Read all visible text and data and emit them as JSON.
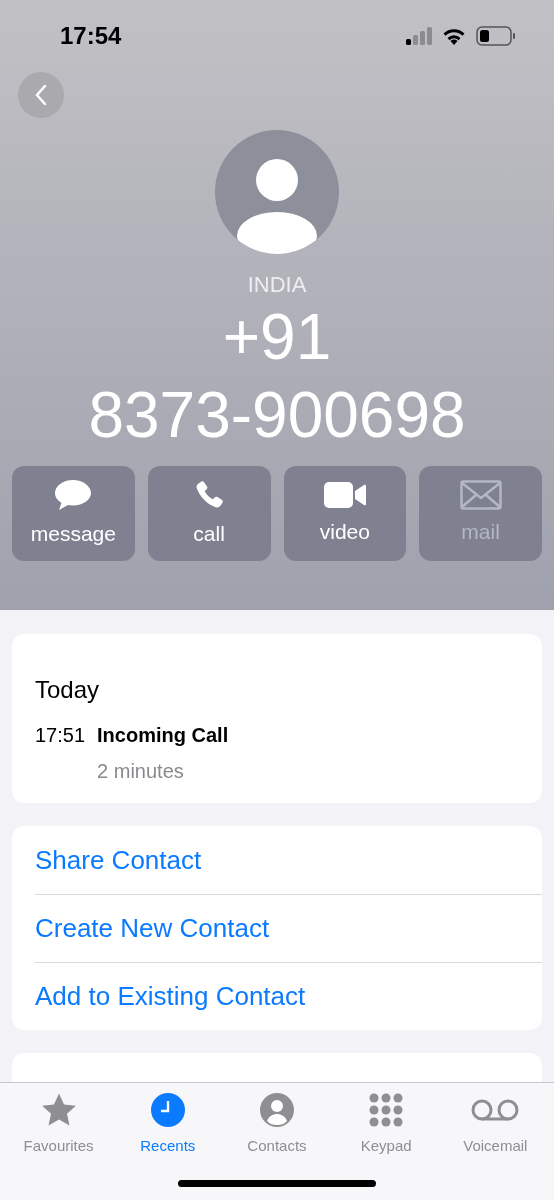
{
  "status_bar": {
    "time": "17:54"
  },
  "contact": {
    "country": "INDIA",
    "number_lines": [
      "+91",
      "8373-900698"
    ]
  },
  "actions": [
    {
      "kind": "message",
      "label": "message",
      "disabled": false
    },
    {
      "kind": "call",
      "label": "call",
      "disabled": false
    },
    {
      "kind": "video",
      "label": "video",
      "disabled": false
    },
    {
      "kind": "mail",
      "label": "mail",
      "disabled": true
    }
  ],
  "history": {
    "heading": "Today",
    "entries": [
      {
        "time": "17:51",
        "type": "Incoming Call",
        "duration": "2 minutes"
      }
    ]
  },
  "contact_actions": [
    "Share Contact",
    "Create New Contact",
    "Add to Existing Contact"
  ],
  "tab_bar": [
    {
      "kind": "favourites",
      "label": "Favourites",
      "selected": false
    },
    {
      "kind": "recents",
      "label": "Recents",
      "selected": true
    },
    {
      "kind": "contacts",
      "label": "Contacts",
      "selected": false
    },
    {
      "kind": "keypad",
      "label": "Keypad",
      "selected": false
    },
    {
      "kind": "voicemail",
      "label": "Voicemail",
      "selected": false
    }
  ]
}
